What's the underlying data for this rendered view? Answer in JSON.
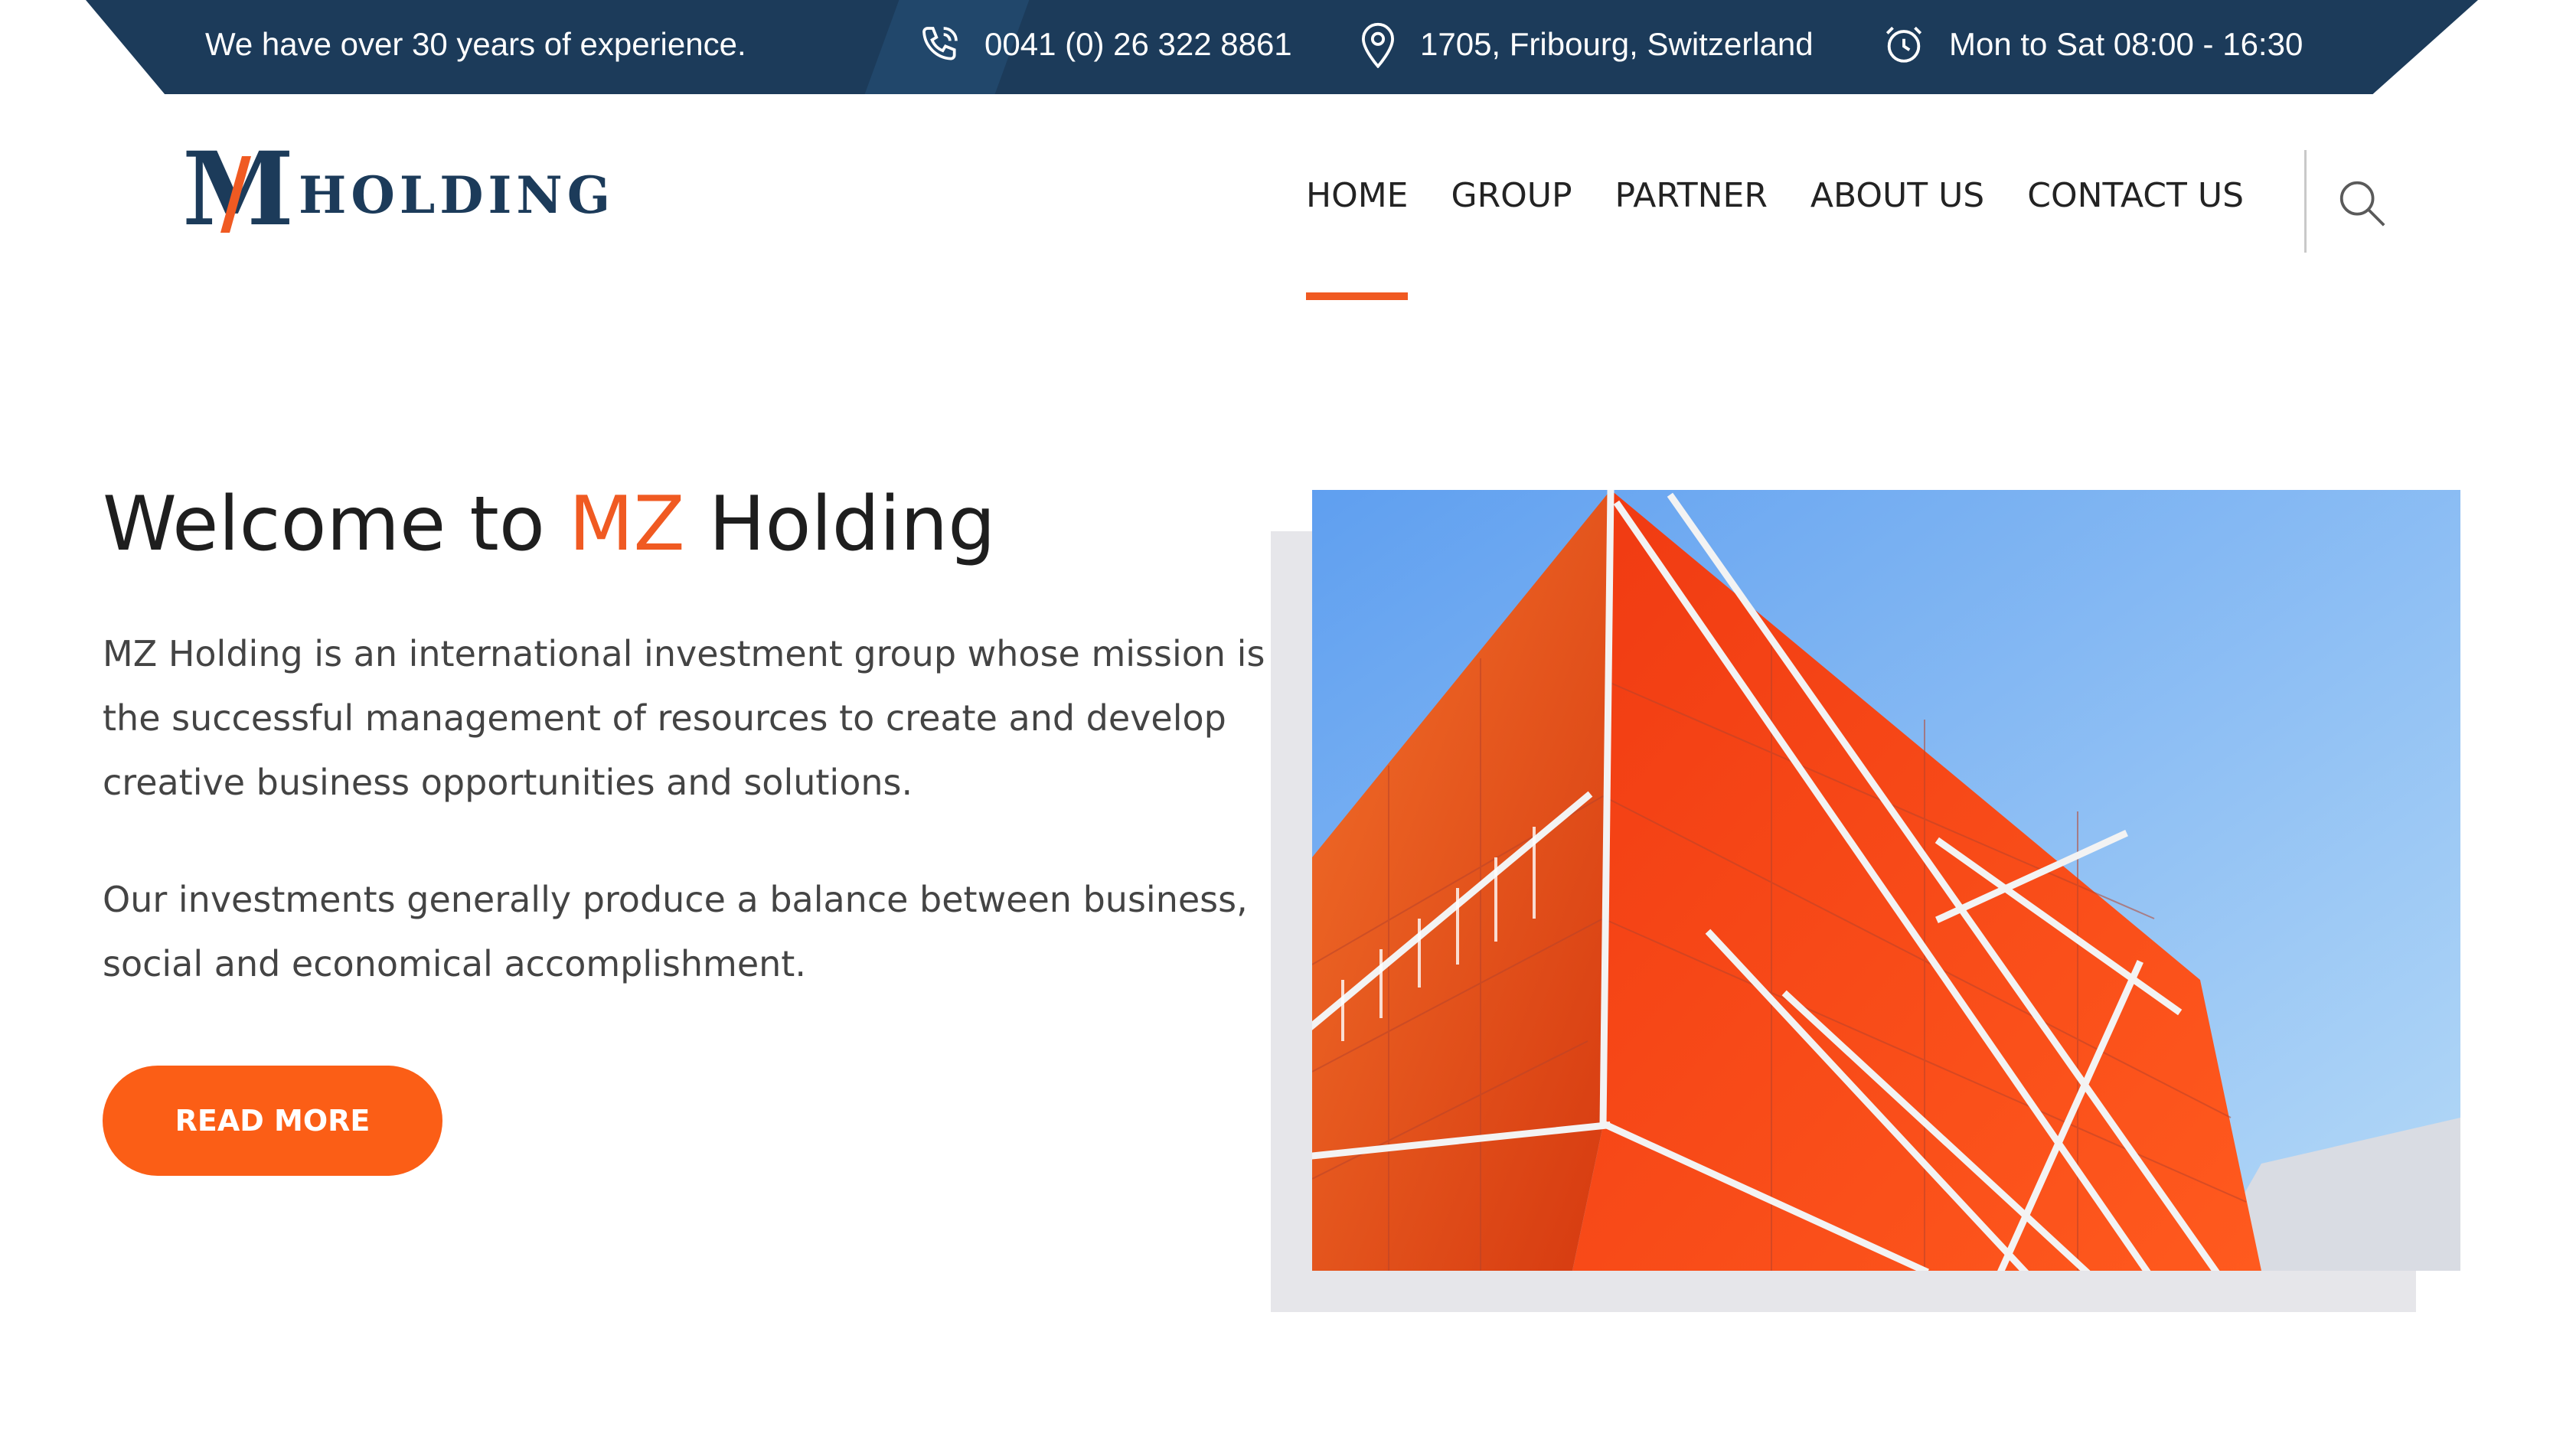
{
  "topbar": {
    "experience": "We have over 30 years of experience.",
    "phone": "0041 (0) 26 322 8861",
    "address": "1705, Fribourg, Switzerland",
    "hours": "Mon to Sat 08:00 - 16:30"
  },
  "logo": {
    "text": "HOLDING",
    "mark": "M"
  },
  "nav": {
    "items": [
      {
        "label": "HOME",
        "active": true
      },
      {
        "label": "GROUP"
      },
      {
        "label": "PARTNER"
      },
      {
        "label": "ABOUT US"
      },
      {
        "label": "CONTACT US"
      }
    ],
    "search_icon": "search-icon"
  },
  "hero": {
    "title_pre": "Welcome to ",
    "title_accent": "MZ",
    "title_post": " Holding",
    "para1": "MZ Holding is an international investment group whose mission is the successful management of resources to create and develop creative business opportunities and solutions.",
    "para2": "Our investments generally produce a balance between business, social and economical accomplishment.",
    "button": "READ MORE"
  },
  "colors": {
    "navy": "#1c3b5a",
    "accent": "#f05a22",
    "button": "#fb5e16"
  }
}
